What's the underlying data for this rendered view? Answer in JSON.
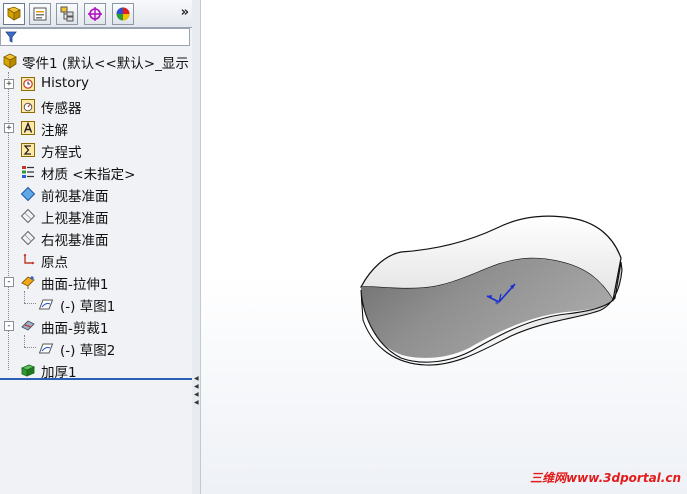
{
  "tabs": {
    "items": [
      {
        "name": "feature-manager"
      },
      {
        "name": "property-manager"
      },
      {
        "name": "configuration-manager"
      },
      {
        "name": "dimxpert-manager"
      },
      {
        "name": "display-manager"
      }
    ],
    "more": "»"
  },
  "tree": {
    "root": "零件1 (默认<<默认>_显示",
    "items": [
      {
        "label": "History",
        "icon": "history-icon",
        "expandable": true
      },
      {
        "label": "传感器",
        "icon": "sensor-icon",
        "expandable": false
      },
      {
        "label": "注解",
        "icon": "annotation-icon",
        "expandable": true
      },
      {
        "label": "方程式",
        "icon": "equation-icon",
        "expandable": false
      },
      {
        "label": "材质 <未指定>",
        "icon": "material-icon",
        "expandable": false
      },
      {
        "label": "前视基准面",
        "icon": "plane-icon",
        "expandable": false
      },
      {
        "label": "上视基准面",
        "icon": "plane-icon",
        "expandable": false
      },
      {
        "label": "右视基准面",
        "icon": "plane-icon",
        "expandable": false
      },
      {
        "label": "原点",
        "icon": "origin-icon",
        "expandable": false
      },
      {
        "label": "曲面-拉伸1",
        "icon": "surface-extrude-icon",
        "expandable": true,
        "expanded": true
      },
      {
        "label": "(-) 草图1",
        "icon": "sketch-icon",
        "child": true
      },
      {
        "label": "曲面-剪裁1",
        "icon": "surface-trim-icon",
        "expandable": true,
        "expanded": true
      },
      {
        "label": "(-) 草图2",
        "icon": "sketch-icon",
        "child": true
      },
      {
        "label": "加厚1",
        "icon": "thicken-icon",
        "expandable": false
      }
    ]
  },
  "watermark": "三维网www.3dportal.cn",
  "colors": {
    "accent": "#2c5fb3",
    "watermark": "#e31b1b",
    "surface_dark": "#8a8a8a",
    "surface_light": "#f5f5f5"
  }
}
